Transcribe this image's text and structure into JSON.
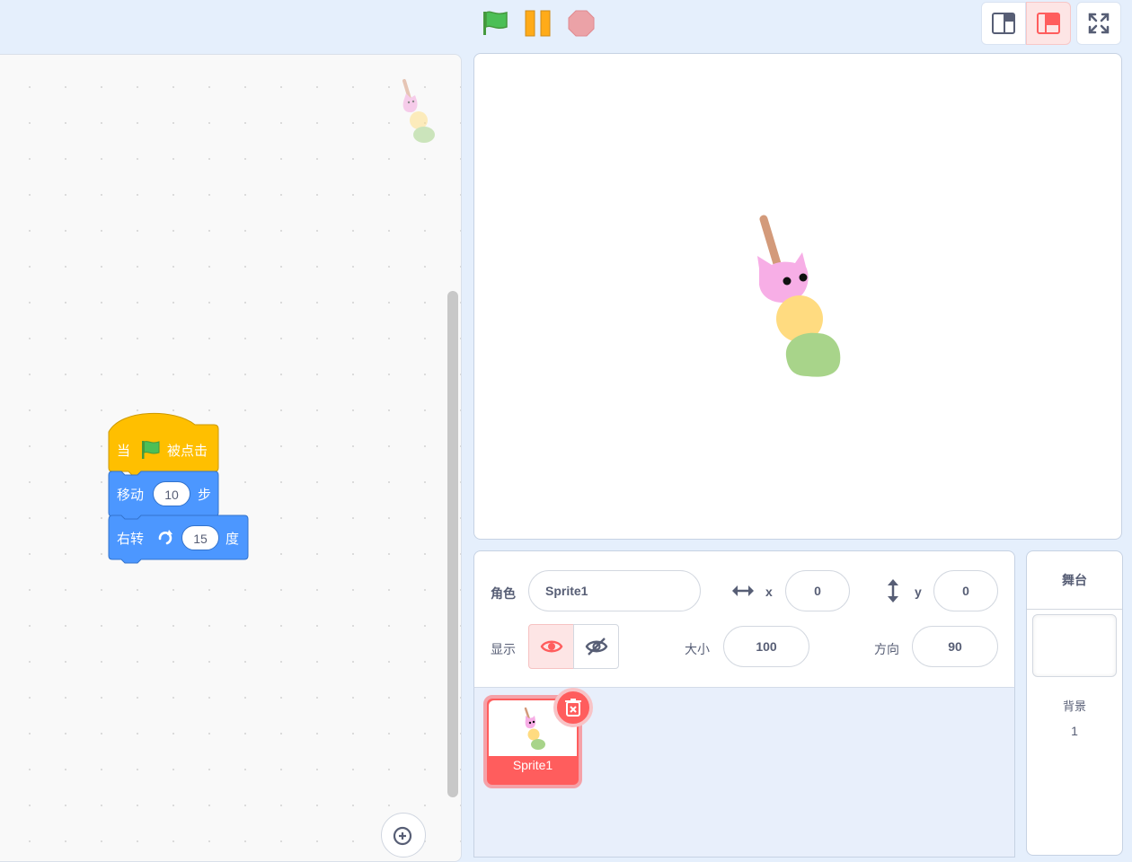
{
  "controls": {
    "green_flag": "green-flag-icon",
    "pause": "pause-icon",
    "stop": "stop-icon"
  },
  "view_modes": {
    "small_stage": "small-stage-icon",
    "normal_stage": "normal-stage-icon",
    "fullscreen": "fullscreen-icon"
  },
  "code": {
    "blocks": [
      {
        "type": "event",
        "parts": [
          "当",
          "被点击"
        ]
      },
      {
        "type": "motion",
        "parts": [
          "移动",
          "步"
        ],
        "input": "10"
      },
      {
        "type": "motion",
        "parts": [
          "右转",
          "度"
        ],
        "input": "15"
      }
    ]
  },
  "sprite_info": {
    "sprite_label": "角色",
    "sprite_name": "Sprite1",
    "x_label": "x",
    "x_value": "0",
    "y_label": "y",
    "y_value": "0",
    "show_label": "显示",
    "size_label": "大小",
    "size_value": "100",
    "direction_label": "方向",
    "direction_value": "90"
  },
  "sprite_list": {
    "items": [
      {
        "name": "Sprite1",
        "selected": true
      }
    ]
  },
  "stage_panel": {
    "header": "舞台",
    "backdrop_label": "背景",
    "backdrop_count": "1"
  },
  "colors": {
    "event_block": "#ffbf00",
    "motion_block": "#4c97ff",
    "accent": "#ff5d5d",
    "background": "#e5effc"
  }
}
